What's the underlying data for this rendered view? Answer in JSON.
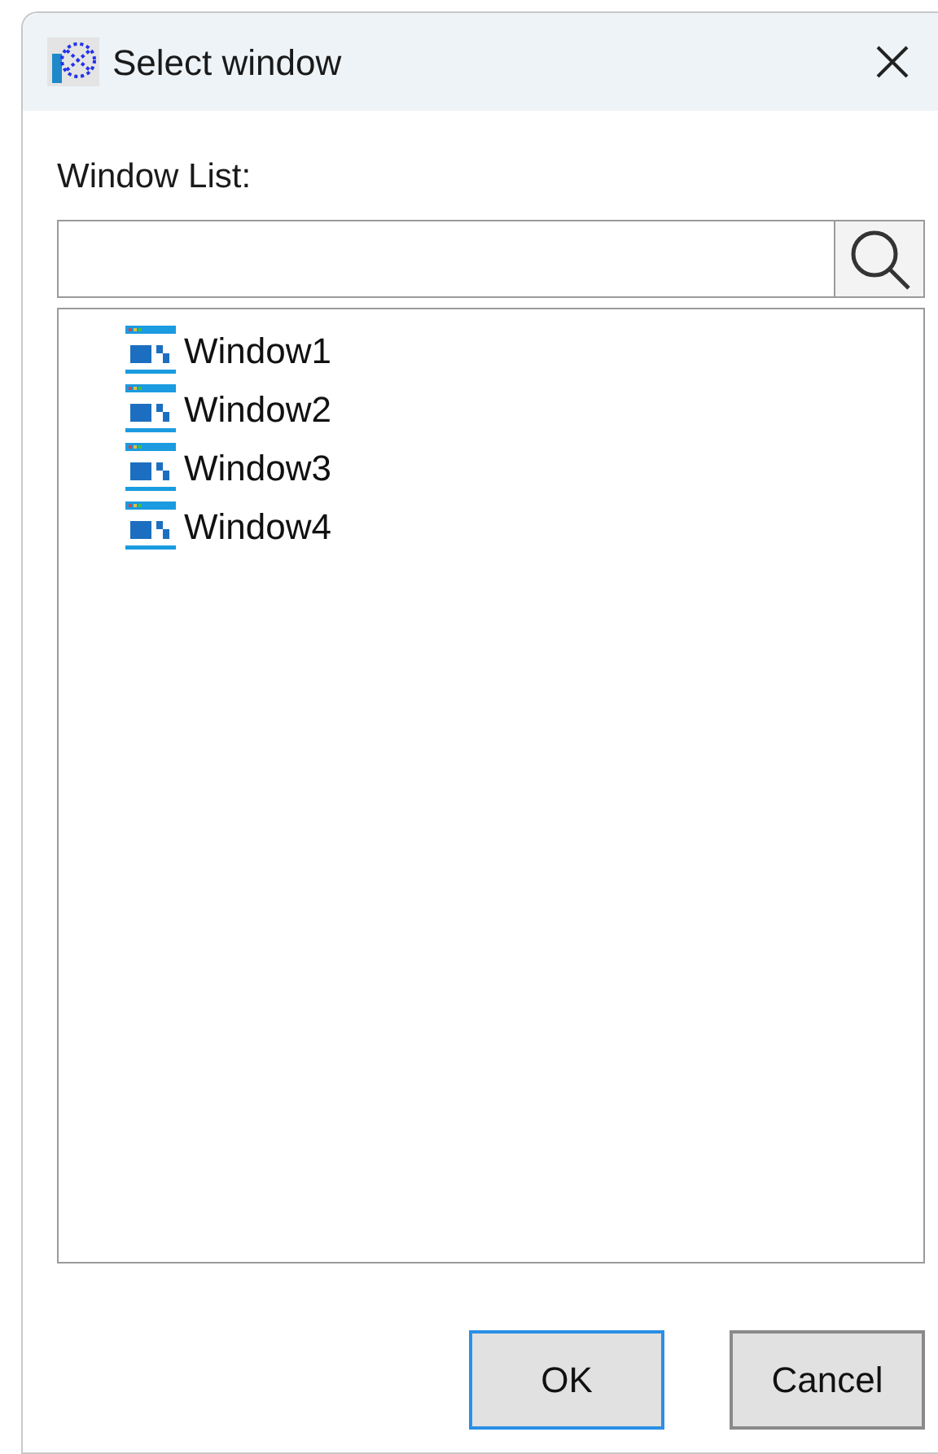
{
  "window": {
    "title": "Select window"
  },
  "label": "Window List:",
  "windows": [
    {
      "name": "Window1"
    },
    {
      "name": "Window2"
    },
    {
      "name": "Window3"
    },
    {
      "name": "Window4"
    }
  ],
  "buttons": [
    {
      "label": "OK",
      "focused": true
    },
    {
      "label": "Cancel",
      "focused": false
    }
  ]
}
